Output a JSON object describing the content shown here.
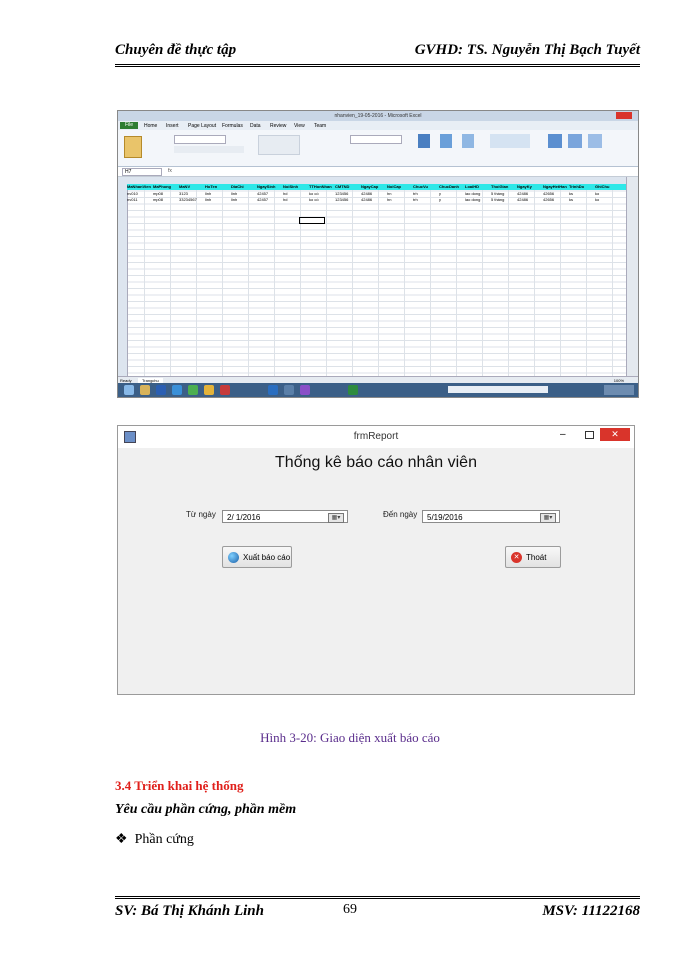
{
  "header": {
    "left": "Chuyên đề thực tập",
    "right": "GVHD: TS. Nguyễn Thị Bạch Tuyết"
  },
  "excel": {
    "window_title": "nhanvien_19-05-2016 - Microsoft Excel",
    "tabs": [
      "File",
      "Home",
      "Insert",
      "Page Layout",
      "Formulas",
      "Data",
      "Review",
      "View",
      "Team"
    ],
    "name_box": "H7",
    "sheet_tab": "Trangchu",
    "status": "Ready",
    "zoom": "100%",
    "columns": [
      "A",
      "B",
      "C",
      "D",
      "E",
      "F",
      "G",
      "H",
      "I",
      "J",
      "K",
      "L",
      "M",
      "N",
      "O",
      "P",
      "Q",
      "R",
      "S",
      "T"
    ],
    "header_row": [
      "MaNhanVien",
      "MaPhong",
      "MaNV",
      "HoTen",
      "DiaChi",
      "NgaySinh",
      "NoiSinh",
      "TTHonNhan",
      "CMTND",
      "NgayCap",
      "NoiCap",
      "ChucVu",
      "ChucDanh",
      "LoaiHD",
      "ThoiGian",
      "NgayKy",
      "NgayHetHan",
      "TrinhDo",
      "GhiChu"
    ],
    "rows": [
      [
        "nv010",
        "mp08",
        "3123",
        "linh",
        "linh",
        "42457",
        "hd",
        "ko có",
        "123456",
        "42486",
        "hn",
        "trh",
        "y",
        "lao dong",
        "5 tháng",
        "42486",
        "42656",
        "ks",
        "ko"
      ],
      [
        "nv011",
        "mp08",
        "33234567",
        "linh",
        "linh",
        "42457",
        "hd",
        "ko có",
        "123456",
        "42486",
        "hn",
        "trh",
        "y",
        "lao dong",
        "5 tháng",
        "42486",
        "42656",
        "ks",
        "ko"
      ]
    ]
  },
  "form": {
    "window_title": "frmReport",
    "heading": "Thống kê báo cáo nhân viên",
    "from_label": "Từ ngày",
    "from_value": "2/ 1/2016",
    "to_label": "Đến ngày",
    "to_value": "5/19/2016",
    "export_button": "Xuất báo cáo",
    "exit_button": "Thoát"
  },
  "caption": "Hình 3-20: Giao diện xuất báo cáo",
  "section_title": "3.4 Triển khai hệ thống",
  "subheading": "Yêu cầu phần cứng, phần mềm",
  "bullet": "Phần cứng",
  "footer": {
    "left": "SV: Bá Thị Khánh Linh",
    "page": "69",
    "right": "MSV: 11122168"
  },
  "colors": {
    "header_row": "#2ee8e8",
    "caption": "#5a2d8c",
    "section": "#e0201b",
    "close_button": "#d9342b"
  }
}
